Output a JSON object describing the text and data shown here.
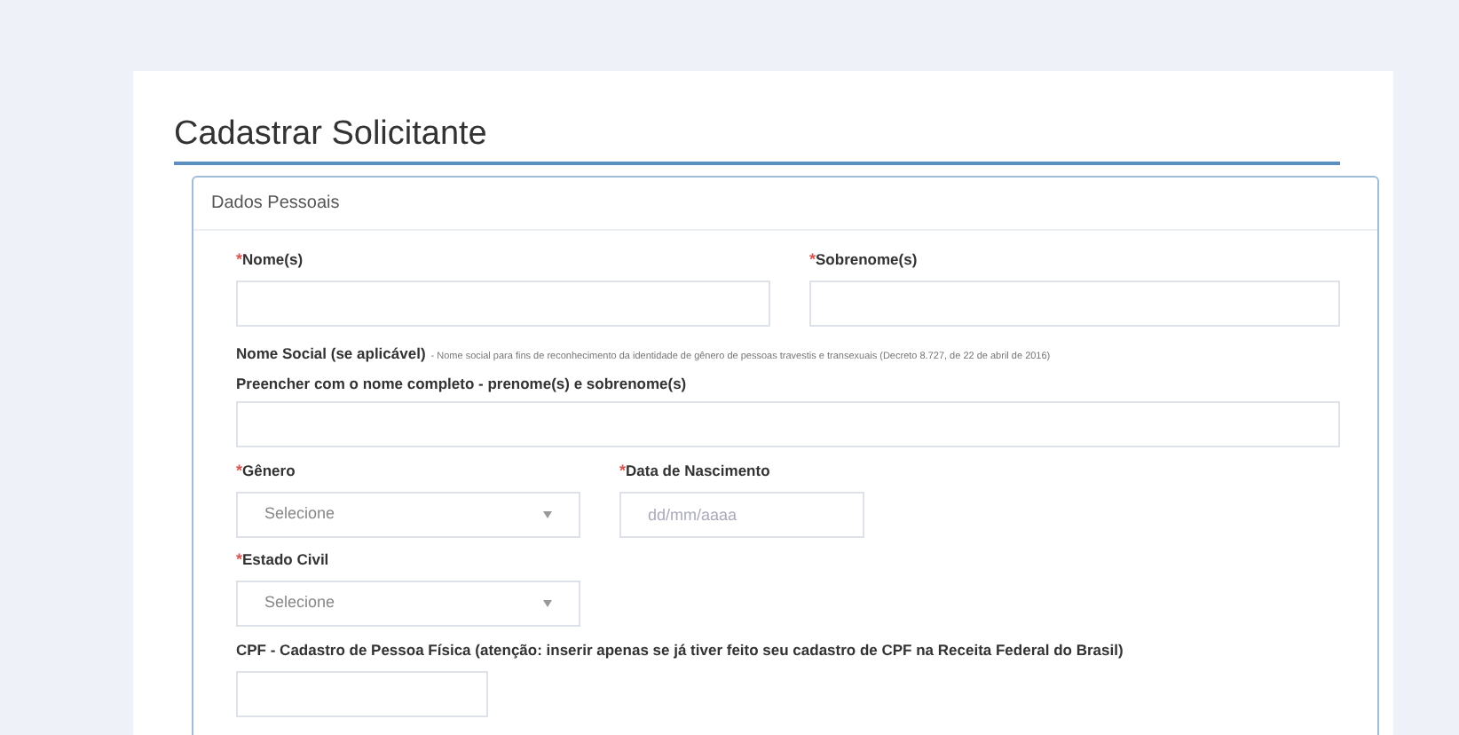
{
  "title": "Cadastrar Solicitante",
  "section": {
    "title": "Dados Pessoais"
  },
  "fields": {
    "nome": {
      "mark": "*",
      "label": "Nome(s)"
    },
    "sobrenome": {
      "mark": "*",
      "label": "Sobrenome(s)"
    },
    "nome_social": {
      "label": "Nome Social (se aplicável)",
      "note": "- Nome social para fins de reconhecimento da identidade de gênero de pessoas travestis e transexuais (Decreto 8.727, de 22 de abril de 2016)",
      "hint": "Preencher com o nome completo - prenome(s) e sobrenome(s)"
    },
    "genero": {
      "mark": "*",
      "label": "Gênero",
      "value": "Selecione"
    },
    "nascimento": {
      "mark": "*",
      "label": "Data de Nascimento",
      "placeholder": "dd/mm/aaaa"
    },
    "estado_civil": {
      "mark": "*",
      "label": "Estado Civil",
      "value": "Selecione"
    },
    "cpf": {
      "label": "CPF - Cadastro de Pessoa Física (atenção: inserir apenas se já tiver feito seu cadastro de CPF na Receita Federal do Brasil)"
    }
  }
}
